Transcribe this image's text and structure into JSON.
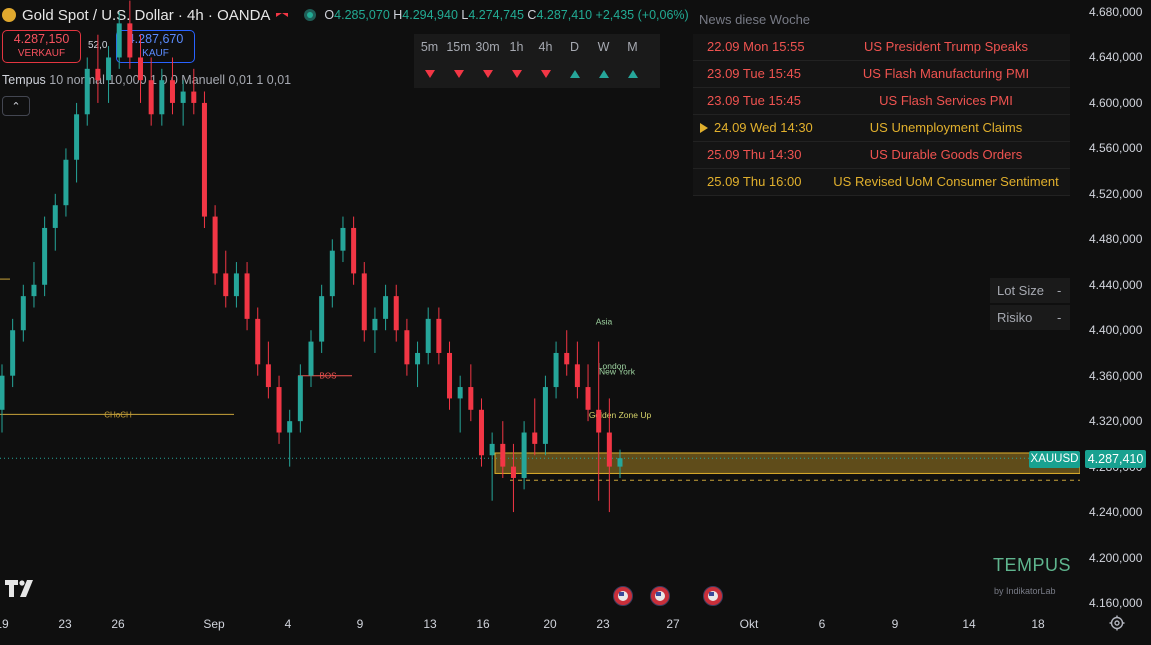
{
  "header": {
    "symbol_title": "Gold Spot / U.S. Dollar · 4h · OANDA",
    "ohlc": [
      {
        "k": "O",
        "v": "4.285,070"
      },
      {
        "k": "H",
        "v": "4.294,940"
      },
      {
        "k": "L",
        "v": "4.274,745"
      },
      {
        "k": "C",
        "v": "4.287,410"
      }
    ],
    "change": "+2,435 (+0,06%)",
    "icons": {
      "symbol": "gold-coin-icon",
      "flag": "flag-icon",
      "status": "market-open-icon"
    }
  },
  "trade": {
    "sell_price": "4.287,150",
    "sell_label": "VERKAUF",
    "spread": "52,0",
    "buy_price": "4.287,670",
    "buy_label": "KAUF"
  },
  "indicator": {
    "name": "Tempus",
    "params": "10 normal 10,000 1 0 0 Manuell 0,01 1 0,01"
  },
  "timeframes": {
    "labels": [
      "5m",
      "15m",
      "30m",
      "1h",
      "4h",
      "D",
      "W",
      "M"
    ],
    "trend": [
      "down",
      "down",
      "down",
      "down",
      "down",
      "up",
      "up",
      "up"
    ]
  },
  "news": {
    "title": "News diese Woche",
    "rows": [
      {
        "date": "22.09 Mon 15:55",
        "event": "US President Trump Speaks",
        "style": "red"
      },
      {
        "date": "23.09 Tue 15:45",
        "event": "US Flash Manufacturing PMI",
        "style": "red"
      },
      {
        "date": "23.09 Tue 15:45",
        "event": "US Flash Services PMI",
        "style": "red"
      },
      {
        "date": "24.09 Wed 14:30",
        "event": "US Unemployment Claims",
        "style": "amber",
        "current": true
      },
      {
        "date": "25.09 Thu 14:30",
        "event": "US Durable Goods Orders",
        "style": "red"
      },
      {
        "date": "25.09 Thu 16:00",
        "event": "US Revised UoM Consumer Sentiment",
        "style": "amber"
      }
    ]
  },
  "risk_panel": {
    "lot_size_label": "Lot Size",
    "lot_size_value": "-",
    "risk_label": "Risiko",
    "risk_value": "-"
  },
  "chart_labels": {
    "choch": "CHoCH",
    "bos": "BOS",
    "asia": "Asia",
    "london": "London",
    "new_york": "New York",
    "golden_zone": "Golden Zone Up"
  },
  "price_axis": [
    "4.680,000",
    "4.640,000",
    "4.600,000",
    "4.560,000",
    "4.520,000",
    "4.480,000",
    "4.440,000",
    "4.400,000",
    "4.360,000",
    "4.320,000",
    "4.280,000",
    "4.240,000",
    "4.200,000",
    "4.160,000"
  ],
  "time_axis": [
    "19",
    "23",
    "26",
    "Sep",
    "4",
    "9",
    "13",
    "16",
    "20",
    "23",
    "27",
    "Okt",
    "6",
    "9",
    "14",
    "18"
  ],
  "last_price": {
    "symbol": "XAUUSD",
    "price": "4.287,410"
  },
  "branding": {
    "name": "TEMPUS",
    "sub": "by IndikatorLab"
  },
  "colors": {
    "up": "#26a69a",
    "down": "#f23645",
    "zone": "#e1b02d",
    "background": "#0f0f0f"
  },
  "chart_data": {
    "type": "candlestick",
    "title": "",
    "symbol": "XAUUSD",
    "timeframe": "4h",
    "ylim": [
      4160,
      4690
    ],
    "last_price": 4287.41,
    "series": [
      {
        "name": "",
        "values": [
          [
            4330,
            4370,
            4310,
            4360
          ],
          [
            4360,
            4410,
            4350,
            4400
          ],
          [
            4400,
            4440,
            4390,
            4430
          ],
          [
            4430,
            4460,
            4420,
            4440
          ],
          [
            4440,
            4500,
            4430,
            4490
          ],
          [
            4490,
            4520,
            4470,
            4510
          ],
          [
            4510,
            4560,
            4500,
            4550
          ],
          [
            4550,
            4600,
            4530,
            4590
          ],
          [
            4590,
            4640,
            4580,
            4630
          ],
          [
            4630,
            4660,
            4600,
            4620
          ],
          [
            4620,
            4650,
            4600,
            4640
          ],
          [
            4640,
            4680,
            4630,
            4670
          ],
          [
            4670,
            4690,
            4630,
            4640
          ],
          [
            4640,
            4660,
            4600,
            4620
          ],
          [
            4620,
            4640,
            4580,
            4590
          ],
          [
            4590,
            4630,
            4580,
            4620
          ],
          [
            4620,
            4640,
            4590,
            4600
          ],
          [
            4600,
            4620,
            4580,
            4610
          ],
          [
            4610,
            4630,
            4590,
            4600
          ],
          [
            4600,
            4610,
            4490,
            4500
          ],
          [
            4500,
            4510,
            4440,
            4450
          ],
          [
            4450,
            4470,
            4420,
            4430
          ],
          [
            4430,
            4460,
            4420,
            4450
          ],
          [
            4450,
            4460,
            4400,
            4410
          ],
          [
            4410,
            4420,
            4360,
            4370
          ],
          [
            4370,
            4390,
            4340,
            4350
          ],
          [
            4350,
            4360,
            4300,
            4310
          ],
          [
            4310,
            4330,
            4280,
            4320
          ],
          [
            4320,
            4370,
            4310,
            4360
          ],
          [
            4360,
            4400,
            4350,
            4390
          ],
          [
            4390,
            4440,
            4380,
            4430
          ],
          [
            4430,
            4480,
            4420,
            4470
          ],
          [
            4470,
            4500,
            4460,
            4490
          ],
          [
            4490,
            4500,
            4440,
            4450
          ],
          [
            4450,
            4460,
            4390,
            4400
          ],
          [
            4400,
            4420,
            4380,
            4410
          ],
          [
            4410,
            4440,
            4400,
            4430
          ],
          [
            4430,
            4440,
            4390,
            4400
          ],
          [
            4400,
            4410,
            4360,
            4370
          ],
          [
            4370,
            4390,
            4350,
            4380
          ],
          [
            4380,
            4420,
            4370,
            4410
          ],
          [
            4410,
            4420,
            4370,
            4380
          ],
          [
            4380,
            4390,
            4330,
            4340
          ],
          [
            4340,
            4360,
            4310,
            4350
          ],
          [
            4350,
            4370,
            4320,
            4330
          ],
          [
            4330,
            4340,
            4280,
            4290
          ],
          [
            4290,
            4310,
            4250,
            4300
          ],
          [
            4300,
            4320,
            4270,
            4280
          ],
          [
            4280,
            4300,
            4240,
            4270
          ],
          [
            4270,
            4320,
            4260,
            4310
          ],
          [
            4310,
            4340,
            4290,
            4300
          ],
          [
            4300,
            4360,
            4290,
            4350
          ],
          [
            4350,
            4390,
            4340,
            4380
          ],
          [
            4380,
            4400,
            4360,
            4370
          ],
          [
            4370,
            4390,
            4340,
            4350
          ],
          [
            4350,
            4370,
            4320,
            4330
          ],
          [
            4330,
            4390,
            4250,
            4310
          ],
          [
            4310,
            4340,
            4240,
            4280
          ],
          [
            4280,
            4295,
            4270,
            4287.41
          ]
        ]
      }
    ],
    "annotations": [
      {
        "label": "CHoCH",
        "price": 4326
      },
      {
        "label": "BOS",
        "price": 4360
      },
      {
        "label": "Golden Zone Up",
        "from": 4274,
        "to": 4292
      }
    ],
    "grid": false,
    "legend": "none"
  }
}
